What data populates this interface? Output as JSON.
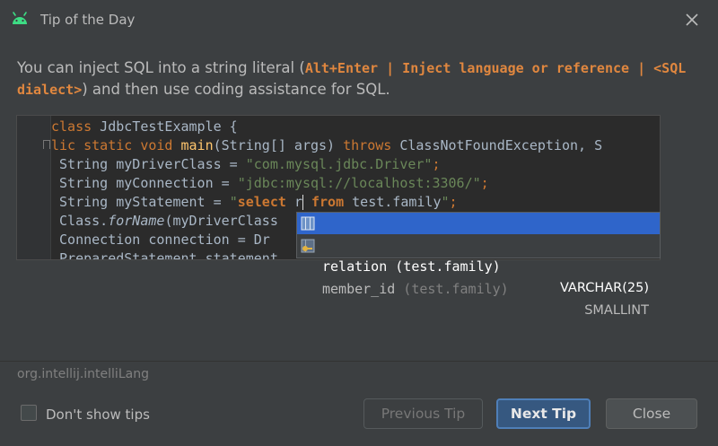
{
  "window": {
    "title": "Tip of the Day",
    "icon": "android-icon",
    "close_icon": "close-icon"
  },
  "tip": {
    "text_before": "You can inject SQL into a string literal (",
    "shortcut": "Alt+Enter | Inject language or reference | <SQL dialect>",
    "text_after": ") and then use coding assistance for SQL."
  },
  "code": {
    "line1": {
      "kw": "class",
      "rest": " JdbcTestExample {"
    },
    "line2": {
      "kw1": "lic static void ",
      "fn": "main",
      "mid": "(String[] args) ",
      "kw2": "throws",
      "rest": " ClassNotFoundException, S"
    },
    "line3": {
      "pre": " String myDriverClass = ",
      "str": "\"com.mysql.jdbc.Driver\"",
      "end": ";"
    },
    "line4": {
      "pre": " String myConnection = ",
      "str": "\"jdbc:mysql://localhost:3306/\"",
      "end": ";"
    },
    "line5": {
      "pre": " String myStatement = ",
      "q": "\"",
      "kw1": "select",
      "sp": " ",
      "typed": "r",
      "sp2": " ",
      "kw2": "from",
      "rest": " test.family",
      "q2": "\"",
      "end": ";"
    },
    "line6": {
      "pre": " Class.",
      "it": "forName",
      "rest": "(myDriverClass"
    },
    "line7": {
      "pre": " Connection connection = Dr"
    },
    "line8": {
      "pre": " PreparedStatement statement"
    }
  },
  "completion": [
    {
      "name": "relation",
      "table": " (test.family)",
      "type": "VARCHAR(25)",
      "icon": "column-icon",
      "selected": true
    },
    {
      "name": "member_id",
      "table": " (test.family)",
      "type": "SMALLINT",
      "icon": "key-column-icon",
      "selected": false
    }
  ],
  "footer": {
    "package": "org.intellij.intelliLang",
    "dont_show": "Don't show tips",
    "previous": "Previous Tip",
    "next": "Next Tip",
    "close": "Close"
  }
}
